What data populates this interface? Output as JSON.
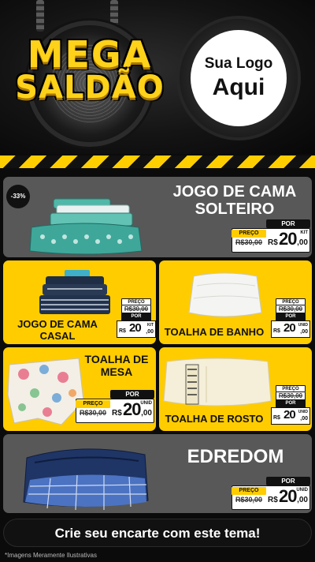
{
  "header": {
    "title_line1": "MEGA",
    "title_line2": "SALDÃO",
    "logo_line1": "Sua Logo",
    "logo_line2": "Aqui"
  },
  "discount_badge": "-33%",
  "products": [
    {
      "name_line1": "JOGO DE CAMA",
      "name_line2": "SOLTEIRO",
      "preco_label": "PREÇO",
      "old_price": "R$30,00",
      "por_label": "POR",
      "currency": "R$",
      "price": "20",
      "cents": ",00",
      "unit": "KIT"
    },
    {
      "name_line1": "JOGO DE CAMA",
      "name_line2": "CASAL",
      "preco_label": "PREÇO",
      "old_price": "R$30,00",
      "por_label": "POR",
      "currency": "R$",
      "price": "20",
      "cents": ",00",
      "unit": "KIT"
    },
    {
      "name_line1": "TOALHA DE BANHO",
      "preco_label": "PREÇO",
      "old_price": "R$30,00",
      "por_label": "POR",
      "currency": "R$",
      "price": "20",
      "cents": ",00",
      "unit": "UNID"
    },
    {
      "name_line1": "TOALHA DE",
      "name_line2": "MESA",
      "preco_label": "PREÇO",
      "old_price": "R$30,00",
      "por_label": "POR",
      "currency": "R$",
      "price": "20",
      "cents": ",00",
      "unit": "UNID"
    },
    {
      "name_line1": "TOALHA DE ROSTO",
      "preco_label": "PREÇO",
      "old_price": "R$30,00",
      "por_label": "POR",
      "currency": "R$",
      "price": "20",
      "cents": ",00",
      "unit": "UNID"
    },
    {
      "name_line1": "EDREDOM",
      "preco_label": "PREÇO",
      "old_price": "R$30,00",
      "por_label": "POR",
      "currency": "R$",
      "price": "20",
      "cents": ",00",
      "unit": "UNID"
    }
  ],
  "footer": {
    "cta": "Crie seu encarte com este tema!",
    "disclaimer": "*Imagens Meramente Ilustrativas"
  },
  "colors": {
    "yellow": "#ffcc00",
    "gray": "#585858",
    "black": "#111111",
    "background": "#0b0b0b"
  }
}
